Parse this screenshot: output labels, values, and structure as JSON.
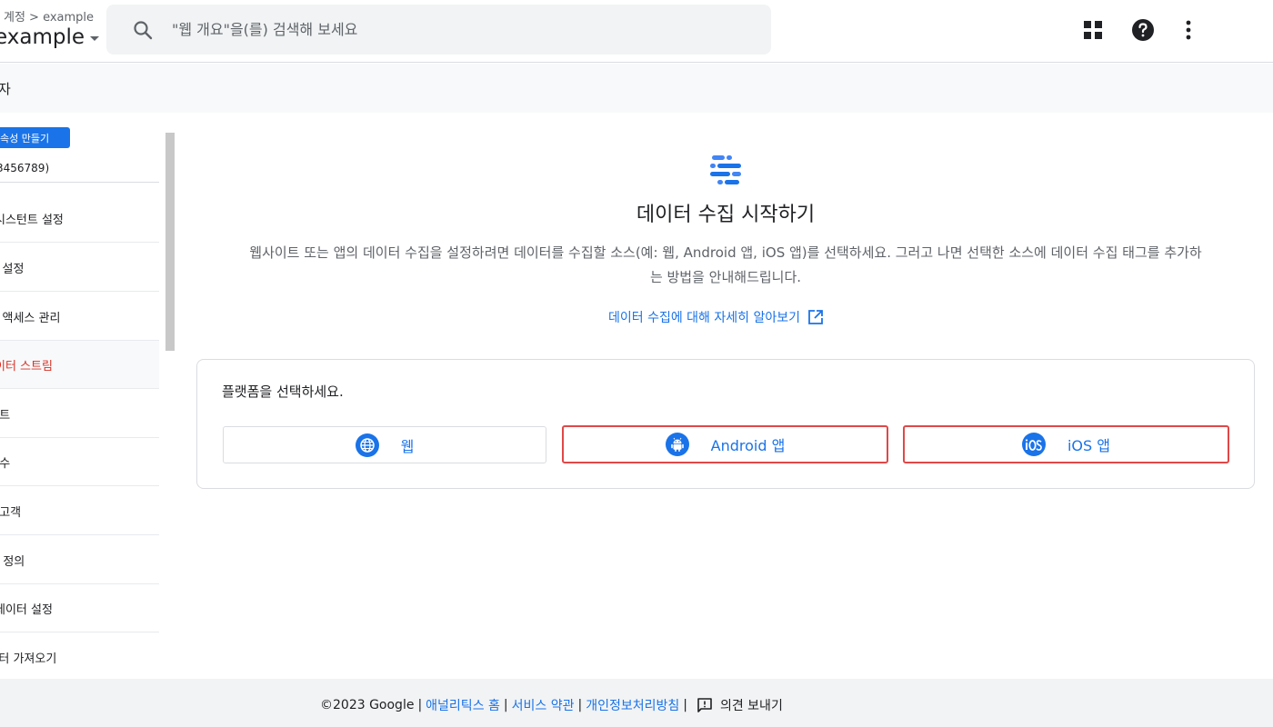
{
  "header": {
    "breadcrumb": "계정 > example",
    "account_name": "example",
    "search_placeholder": "\"웹 개요\"을(를) 검색해 보세요"
  },
  "subheader": {
    "title": "자"
  },
  "sidebar": {
    "create_label": "속성 만들기",
    "property_id": "3456789)",
    "items": [
      {
        "label": "시스턴트 설정"
      },
      {
        "label": "| 설정"
      },
      {
        "label": "| 액세스 관리"
      },
      {
        "label": "이터 스트림"
      },
      {
        "label": "!트"
      },
      {
        "label": "!수"
      },
      {
        "label": "!고객"
      },
      {
        "label": "! 정의"
      },
      {
        "label": "데이터 설정"
      },
      {
        "label": "|터 가져오기"
      }
    ]
  },
  "main": {
    "title": "데이터 수집 시작하기",
    "description": "웹사이트 또는 앱의 데이터 수집을 설정하려면 데이터를 수집할 소스(예: 웹, Android 앱, iOS 앱)를 선택하세요. 그러고 나면 선택한 소스에 데이터 수집 태그를 추가하는 방법을 안내해드립니다.",
    "learn_more": "데이터 수집에 대해 자세히 알아보기",
    "platform_prompt": "플랫폼을 선택하세요.",
    "platforms": [
      {
        "label": "웹",
        "icon": "globe-icon"
      },
      {
        "label": "Android 앱",
        "icon": "android-icon"
      },
      {
        "label": "iOS 앱",
        "icon": "ios-icon"
      }
    ]
  },
  "footer": {
    "copyright": "©2023 Google",
    "analytics_home": "애널리틱스 홈",
    "terms": "서비스 약관",
    "privacy": "개인정보처리방침",
    "feedback": "의견 보내기"
  },
  "colors": {
    "accent": "#1a73e8",
    "highlight_border": "#e04848",
    "active_nav_text": "#d93025"
  }
}
